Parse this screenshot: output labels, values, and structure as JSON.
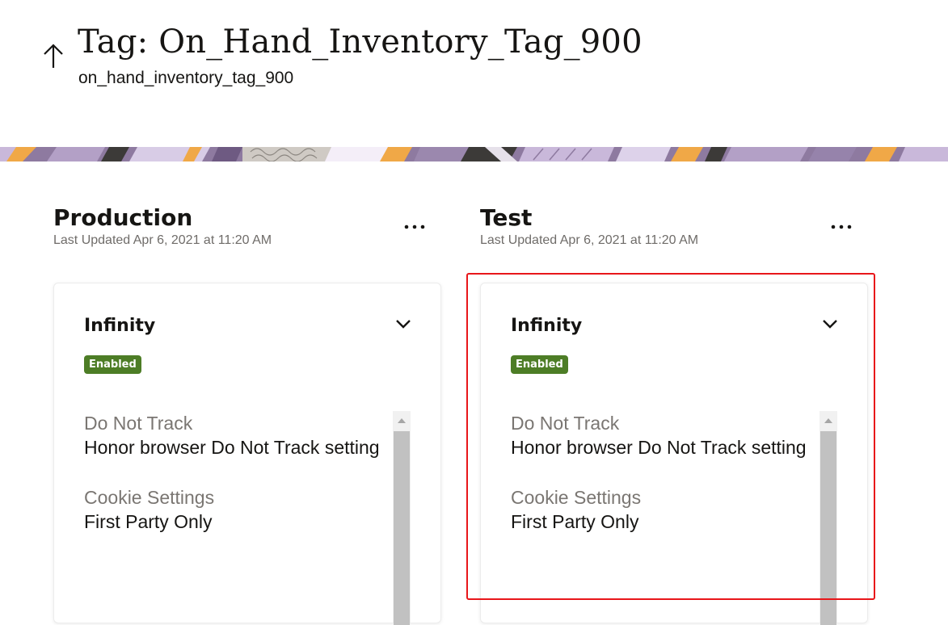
{
  "header": {
    "title": "Tag: On_Hand_Inventory_Tag_900",
    "subtitle": "on_hand_inventory_tag_900",
    "back_icon": "arrow-up-icon"
  },
  "environments": [
    {
      "name": "Production",
      "last_updated": "Last Updated Apr 6, 2021 at 11:20 AM",
      "more_icon": "ellipsis-icon",
      "card": {
        "title": "Infinity",
        "status": "Enabled",
        "settings": [
          {
            "label": "Do Not Track",
            "value": "Honor browser Do Not Track setting"
          },
          {
            "label": "Cookie Settings",
            "value": "First Party Only"
          }
        ]
      }
    },
    {
      "name": "Test",
      "last_updated": "Last Updated Apr 6, 2021 at 11:20 AM",
      "more_icon": "ellipsis-icon",
      "card": {
        "title": "Infinity",
        "status": "Enabled",
        "settings": [
          {
            "label": "Do Not Track",
            "value": "Honor browser Do Not Track setting"
          },
          {
            "label": "Cookie Settings",
            "value": "First Party Only"
          }
        ]
      }
    }
  ],
  "colors": {
    "badge_green": "#4d7d26",
    "highlight_red": "#e8161a",
    "muted_text": "#7a7672"
  }
}
